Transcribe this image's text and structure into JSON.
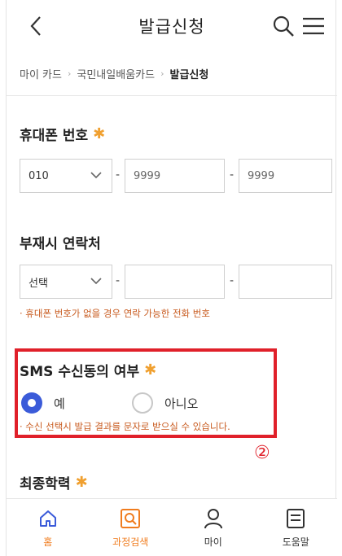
{
  "header": {
    "title": "발급신청",
    "back_icon": "chevron-left-icon",
    "search_icon": "search-icon",
    "menu_icon": "hamburger-menu-icon"
  },
  "breadcrumb": {
    "items": [
      "마이 카드",
      "국민내일배움카드"
    ],
    "current": "발급신청",
    "separator": "›"
  },
  "mobile": {
    "label": "휴대폰 번호",
    "required_mark": "✱",
    "prefix_value": "010",
    "middle_placeholder": "9999",
    "last_placeholder": "9999",
    "dash": "-"
  },
  "alt_contact": {
    "label": "부재시 연락처",
    "select_value": "선택",
    "hint": "· 휴대폰 번호가 없을 경우 연락 가능한 전화 번호",
    "dash": "-"
  },
  "sms": {
    "label": "SMS 수신동의 여부",
    "required_mark": "✱",
    "options": [
      {
        "label": "예",
        "selected": true
      },
      {
        "label": "아니오",
        "selected": false
      }
    ],
    "hint": "· 수신 선택시 발급 결과를 문자로 받으실 수 있습니다.",
    "annotation": "②",
    "highlight_color": "#e0202a"
  },
  "education": {
    "label": "최종학력",
    "required_mark": "✱"
  },
  "bottom_nav": {
    "items": [
      {
        "label": "홈",
        "icon": "home-icon"
      },
      {
        "label": "과정검색",
        "icon": "course-search-icon"
      },
      {
        "label": "마이",
        "icon": "person-icon"
      },
      {
        "label": "도움말",
        "icon": "help-document-icon"
      }
    ]
  },
  "colors": {
    "accent_blue": "#3b5bd9",
    "required_orange": "#f0a030",
    "hint_text": "#c85a1e",
    "nav_active": "#f07c1e"
  }
}
